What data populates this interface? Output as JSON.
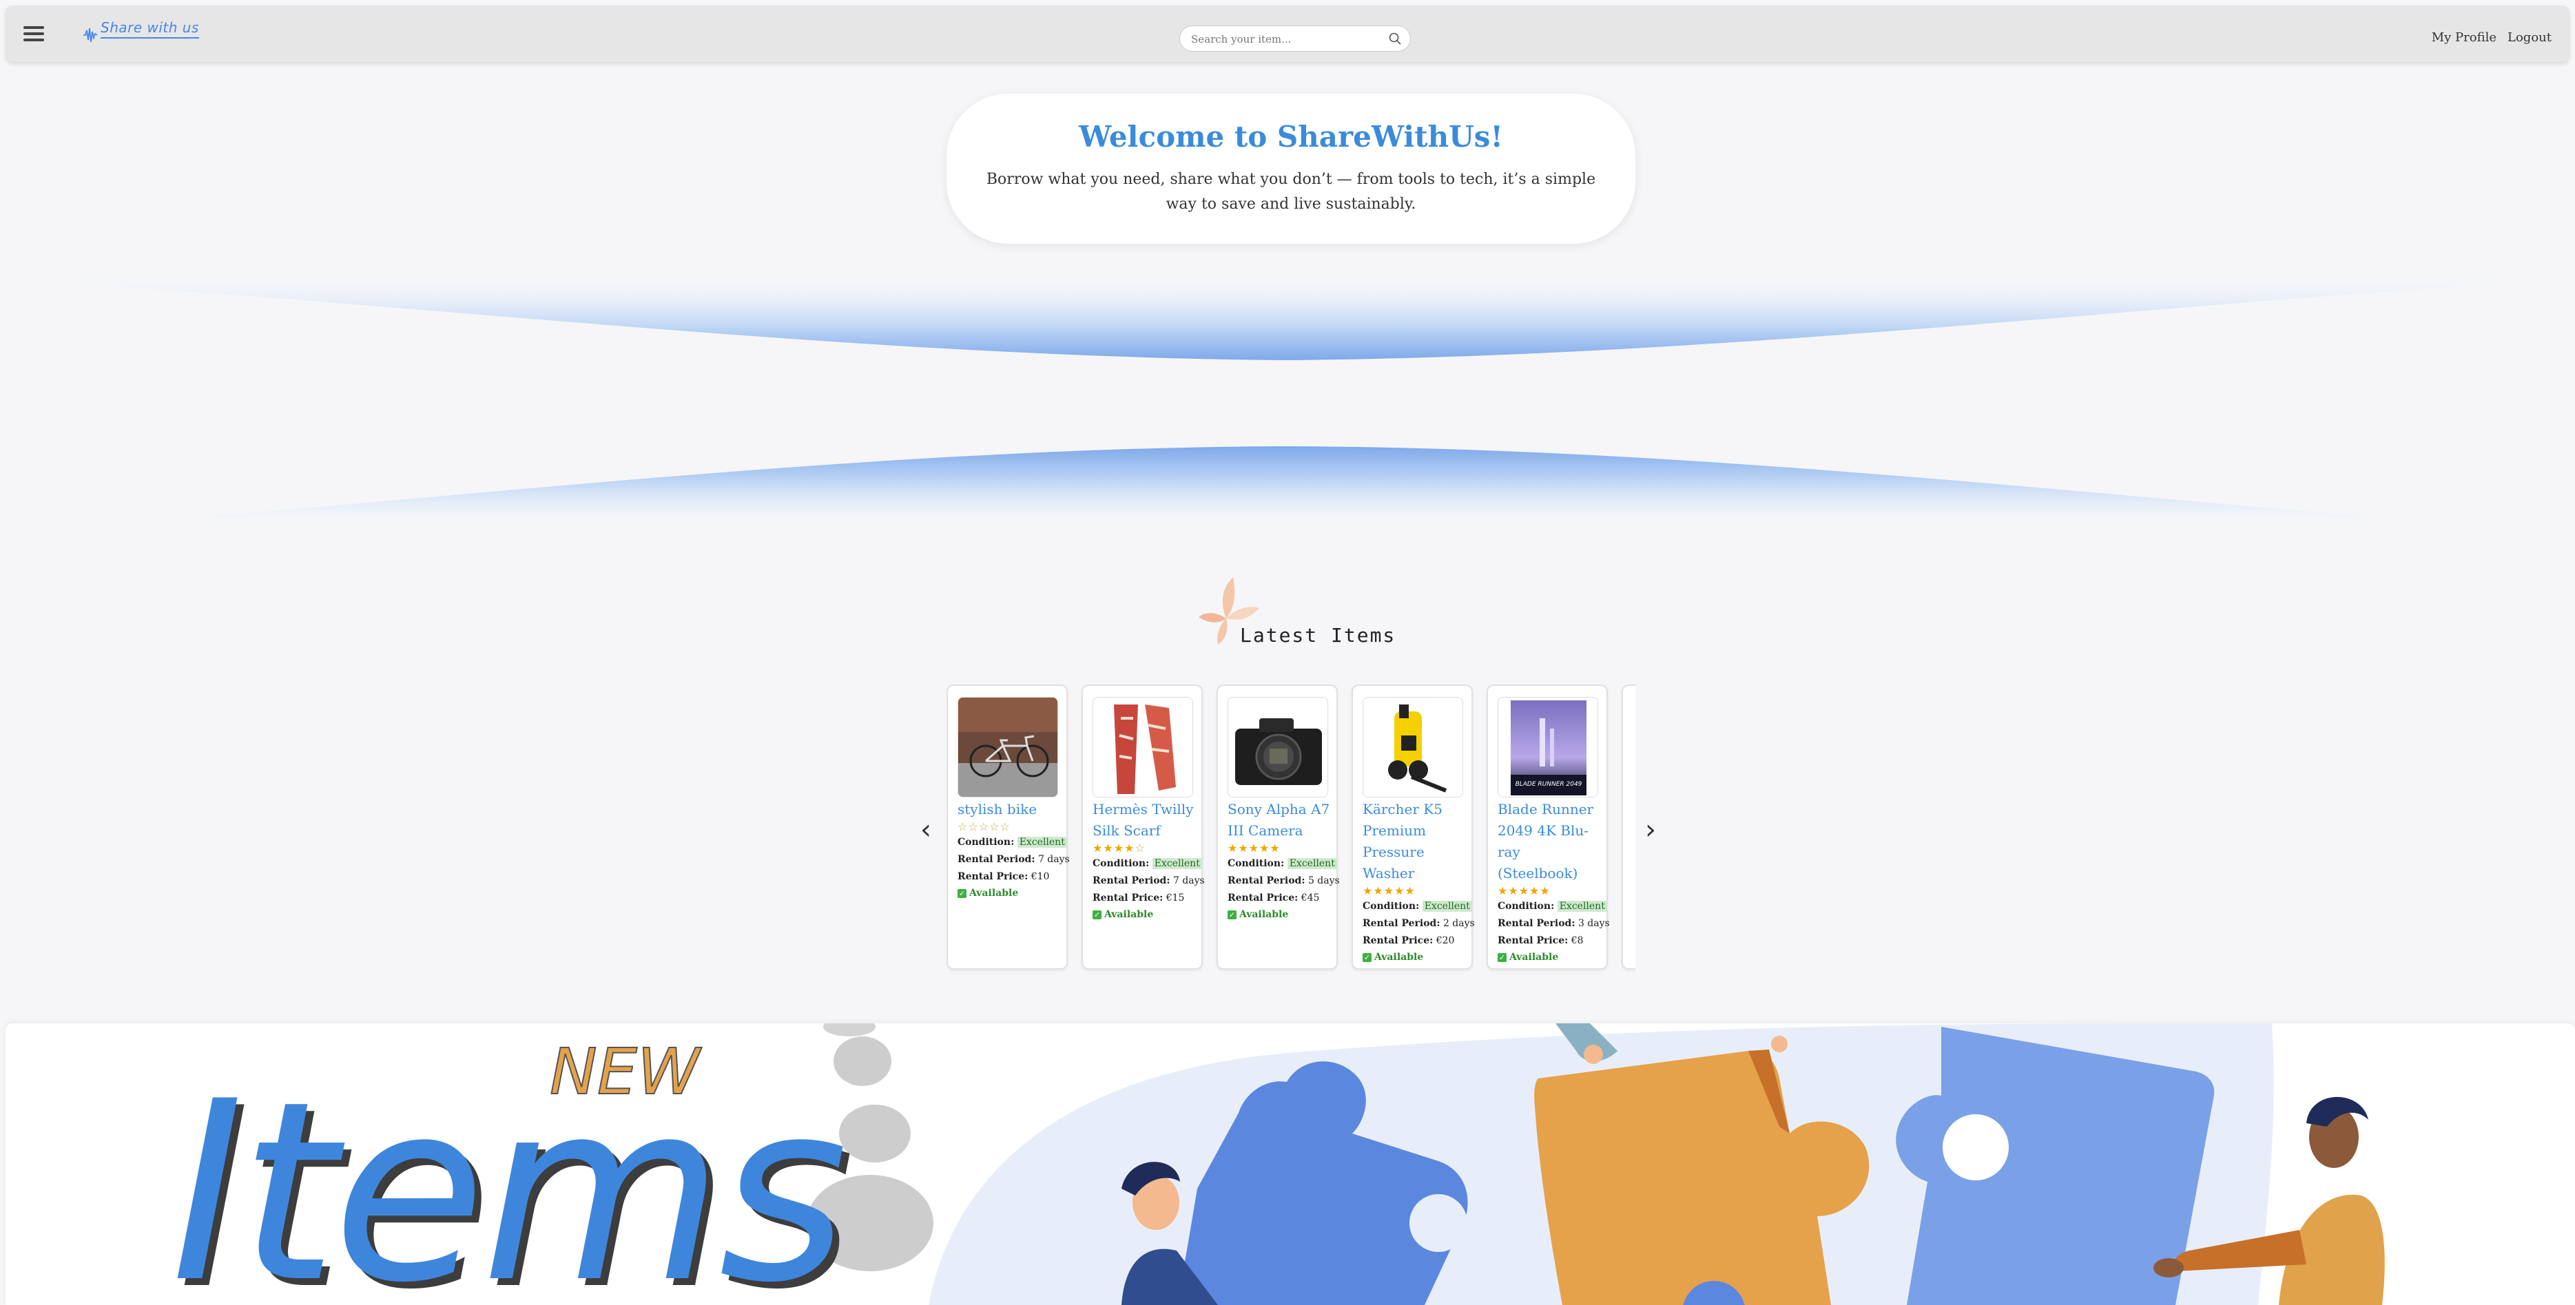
{
  "navbar": {
    "menu_icon": "hamburger-menu-icon",
    "logo_text": "Share with us",
    "search_placeholder": "Search your item...",
    "search_icon": "search-icon",
    "links": [
      "My Profile",
      "Logout"
    ]
  },
  "hero": {
    "title": "Welcome to ShareWithUs!",
    "subtitle": "Borrow what you need, share what you don’t — from tools to tech, it’s a simple way to save and live sustainably."
  },
  "latest": {
    "title": "Latest Items",
    "icon": "leaf-flower-icon",
    "prev_icon": "chevron-left-icon",
    "next_icon": "chevron-right-icon",
    "prev": "‹",
    "next": "›",
    "condition_label": "Condition:",
    "period_label": "Rental Period:",
    "price_label": "Rental Price:",
    "items": [
      {
        "name": "stylish bike",
        "rating": 0,
        "condition": "Excellent",
        "period": "7 days",
        "price": "€10",
        "status": "Available"
      },
      {
        "name": "Hermès Twilly Silk Scarf",
        "rating": 4,
        "condition": "Excellent",
        "period": "7 days",
        "price": "€15",
        "status": "Available"
      },
      {
        "name": "Sony Alpha A7 III Camera",
        "rating": 5,
        "condition": "Excellent",
        "period": "5 days",
        "price": "€45",
        "status": "Available"
      },
      {
        "name": "Kärcher K5 Premium Pressure Washer",
        "rating": 5,
        "condition": "Excellent",
        "period": "2 days",
        "price": "€20",
        "status": "Available"
      },
      {
        "name": "Blade Runner 2049 4K Blu-ray (Steelbook)",
        "rating": 5,
        "condition": "Excellent",
        "period": "3 days",
        "price": "€8",
        "status": "Available"
      }
    ]
  },
  "banner": {
    "word_new": "NEW",
    "word_items": "Items",
    "steelbook_text": "BLADE RUNNER 2049"
  }
}
